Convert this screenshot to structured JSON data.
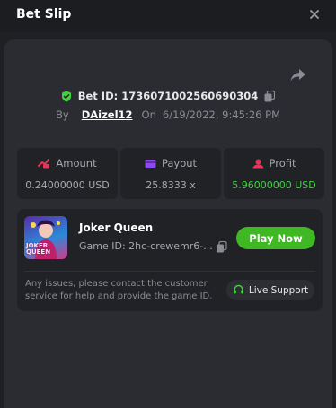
{
  "header": {
    "title": "Bet Slip"
  },
  "bet": {
    "bet_id": "Bet ID: 1736071002560690304",
    "by_label": "By",
    "username": "DAizel12",
    "on_label": "On",
    "datetime": "6/19/2022, 9:45:26 PM"
  },
  "stats": {
    "amount": {
      "label": "Amount",
      "value": "0.24000000 USD"
    },
    "payout": {
      "label": "Payout",
      "value": "25.8333 x"
    },
    "profit": {
      "label": "Profit",
      "value": "5.96000000 USD"
    }
  },
  "game": {
    "thumb_text": "JOKER QUEEN",
    "name": "Joker Queen",
    "game_id": "Game ID: 2hc-crewemr6-...",
    "play_label": "Play Now"
  },
  "support": {
    "notice": "Any issues, please contact the customer service for help and provide the game ID.",
    "button_label": "Live Support"
  },
  "colors": {
    "accent_green": "#3fb823",
    "profit_green": "#3fd23e",
    "amount_icon": "#e0385a",
    "payout_icon": "#8a4be8",
    "profit_icon": "#e0385a"
  },
  "icons": [
    "close-icon",
    "share-icon",
    "shield-check-icon",
    "copy-icon",
    "amount-icon",
    "payout-icon",
    "profit-icon",
    "headset-icon"
  ]
}
